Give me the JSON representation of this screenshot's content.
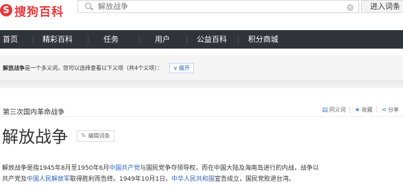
{
  "header": {
    "logo_mark": "S",
    "logo_text": "搜狗百科",
    "search_placeholder": "解放战争",
    "clear_glyph": "×",
    "enter_label": "进入词条"
  },
  "nav": {
    "items": [
      "首页",
      "精彩百科",
      "任务",
      "用户",
      "公益百科",
      "积分商城"
    ]
  },
  "ambiguity": {
    "term": "解放战争",
    "text": "是一个多义词，您可以选择查看以下义项（共4个义项）：",
    "expand_label": "展开",
    "expand_chevron": "∨"
  },
  "entry": {
    "category_title": "第三次国内革命战争",
    "actions": {
      "synonym": "同义词",
      "favorite": "收藏",
      "share": "分享"
    },
    "title": "解放战争",
    "edit_label": "编辑词条"
  },
  "paragraph": {
    "p1": "解放战争是指1945年8月至1950年6月",
    "link1": "中国共产党",
    "p2": "与国民党争夺领导权，而在中国大陆及海南岛进行的内战，战争以",
    "p3": "共产党及",
    "link2": "中国人民解放军",
    "p4": "取得胜利而告终。1949年10月1日，",
    "link3": "中华人民共和国",
    "p5": "宣告成立，国民党败退台湾。"
  },
  "colors": {
    "brand_red": "#e4393c",
    "nav_bg": "#2f343a",
    "link_blue": "#2e63bc"
  }
}
